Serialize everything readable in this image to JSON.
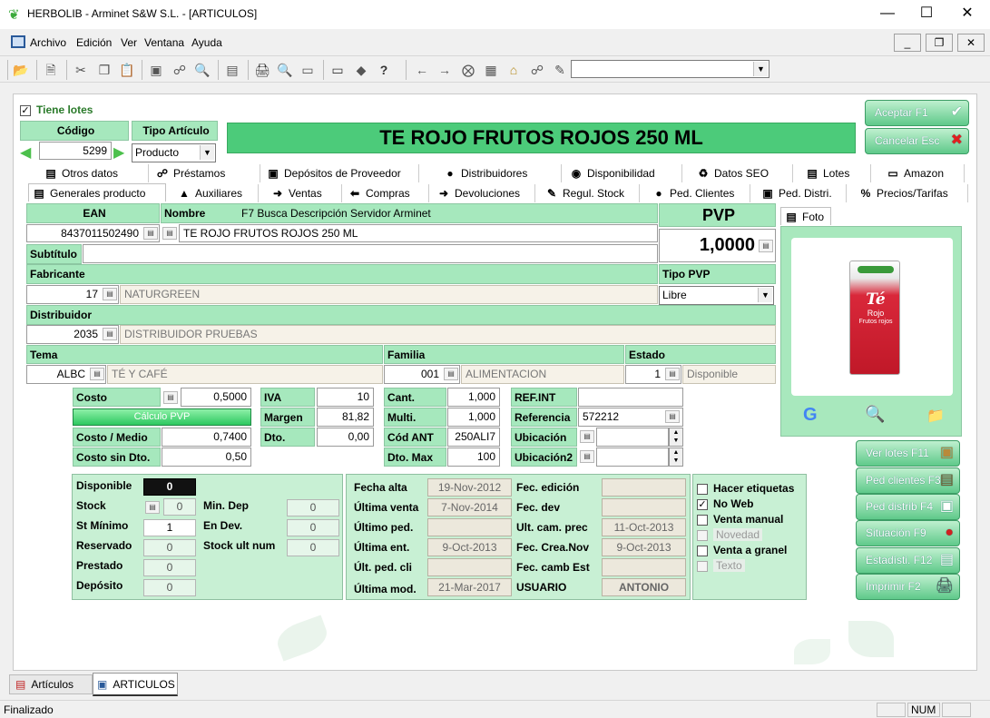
{
  "window": {
    "title": "HERBOLIB - Arminet S&W S.L. - [ARTICULOS]"
  },
  "menu": {
    "items": [
      "Archivo",
      "Edición",
      "Ver",
      "Ventana",
      "Ayuda"
    ]
  },
  "header": {
    "tiene_lotes": "Tiene lotes",
    "codigo_label": "Código",
    "codigo_value": "5299",
    "tipo_label": "Tipo Artículo",
    "tipo_value": "Producto",
    "product_title": "TE ROJO FRUTOS ROJOS 250 ML",
    "aceptar": "Aceptar F1",
    "cancelar": "Cancelar Esc"
  },
  "tabs_row1": [
    "Otros datos",
    "Préstamos",
    "Depósitos de Proveedor",
    "Distribuidores",
    "Disponibilidad",
    "Datos SEO",
    "Lotes",
    "Amazon"
  ],
  "tabs_row2": [
    "Generales producto",
    "Auxiliares",
    "Ventas",
    "Compras",
    "Devoluciones",
    "Regul. Stock",
    "Ped. Clientes",
    "Ped. Distri.",
    "Precios/Tarifas"
  ],
  "general": {
    "ean_label": "EAN",
    "ean_value": "8437011502490",
    "nombre_label": "Nombre",
    "nombre_hint": "F7 Busca Descripción Servidor Arminet",
    "nombre_value": "TE ROJO FRUTOS ROJOS 250 ML",
    "subtitulo_label": "Subtítulo",
    "fabricante_label": "Fabricante",
    "fabricante_code": "17",
    "fabricante_name": "NATURGREEN",
    "distribuidor_label": "Distribuidor",
    "distribuidor_code": "2035",
    "distribuidor_name": "DISTRIBUIDOR PRUEBAS",
    "tema_label": "Tema",
    "tema_code": "ALBC",
    "tema_name": "TÉ Y CAFÉ",
    "familia_label": "Familia",
    "familia_code": "001",
    "familia_name": "ALIMENTACION",
    "estado_label": "Estado",
    "estado_code": "1",
    "estado_name": "Disponible",
    "pvp_label": "PVP",
    "pvp_value": "1,0000",
    "tipo_pvp_label": "Tipo PVP",
    "tipo_pvp_value": "Libre",
    "foto_tab": "Foto"
  },
  "prices": {
    "costo_label": "Costo",
    "costo": "0,5000",
    "calculo_pvp": "Cálculo PVP",
    "costo_medio_label": "Costo / Medio",
    "costo_medio": "0,7400",
    "costo_sin_dto_label": "Costo sin Dto.",
    "costo_sin_dto": "0,50",
    "iva_label": "IVA",
    "iva": "10",
    "margen_label": "Margen",
    "margen": "81,82",
    "dto_label": "Dto.",
    "dto": "0,00",
    "cant_label": "Cant.",
    "cant": "1,000",
    "multi_label": "Multi.",
    "multi": "1,000",
    "cod_ant_label": "Cód ANT",
    "cod_ant": "250ALI7",
    "dto_max_label": "Dto. Max",
    "dto_max": "100",
    "ref_int_label": "REF.INT",
    "ref_int": "",
    "referencia_label": "Referencia",
    "referencia": "572212",
    "ubicacion_label": "Ubicación",
    "ubicacion2_label": "Ubicación2"
  },
  "stock": {
    "disponible_label": "Disponible",
    "disponible": "0",
    "stock_label": "Stock",
    "stock": "0",
    "st_minimo_label": "St Mínimo",
    "st_minimo": "1",
    "reservado_label": "Reservado",
    "reservado": "0",
    "prestado_label": "Prestado",
    "prestado": "0",
    "deposito_label": "Depósito",
    "deposito": "0",
    "min_dep_label": "Min. Dep",
    "min_dep": "0",
    "en_dev_label": "En Dev.",
    "en_dev": "0",
    "stock_ult_label": "Stock ult num",
    "stock_ult": "0"
  },
  "dates": {
    "fecha_alta_label": "Fecha alta",
    "fecha_alta": "19-Nov-2012",
    "ultima_venta_label": "Última venta",
    "ultima_venta": "7-Nov-2014",
    "ultimo_ped_label": "Último ped.",
    "ultimo_ped": "",
    "ultima_ent_label": "Última ent.",
    "ultima_ent": "9-Oct-2013",
    "ult_ped_cli_label": "Últ. ped. cli",
    "ult_ped_cli": "",
    "ultima_mod_label": "Última mod.",
    "ultima_mod": "21-Mar-2017",
    "fec_edicion_label": "Fec. edición",
    "fec_edicion": "",
    "fec_dev_label": "Fec. dev",
    "fec_dev": "",
    "ult_cam_prec_label": "Ult. cam. prec",
    "ult_cam_prec": "11-Oct-2013",
    "fec_crea_nov_label": "Fec. Crea.Nov",
    "fec_crea_nov": "9-Oct-2013",
    "fec_camb_est_label": "Fec. camb Est",
    "fec_camb_est": "",
    "usuario_label": "USUARIO",
    "usuario": "ANTONIO"
  },
  "flags": [
    "Hacer etiquetas",
    "No Web",
    "Venta manual",
    "Novedad",
    "Venta a granel",
    "Texto"
  ],
  "side_buttons": [
    "Ver lotes F11",
    "Ped clientes F3",
    "Ped distrib F4",
    "Situación F9",
    "Estadísti. F12",
    "Imprimir F2"
  ],
  "taskbar": [
    "Artículos",
    "ARTICULOS"
  ],
  "status": {
    "text": "Finalizado",
    "num": "NUM"
  }
}
